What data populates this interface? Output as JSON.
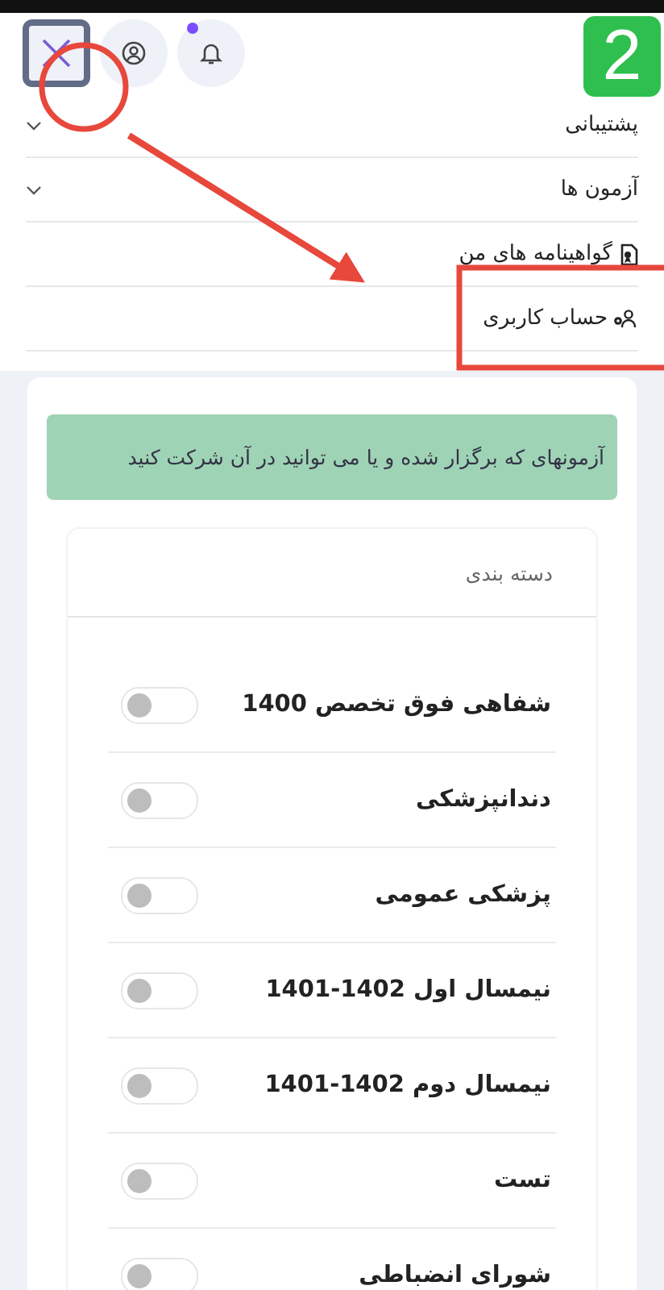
{
  "header": {
    "notifications": {
      "unread": true
    }
  },
  "menu": [
    {
      "label": "پشتیبانی",
      "kind": "dropdown"
    },
    {
      "label": "آزمون ها",
      "kind": "dropdown"
    },
    {
      "label": "گواهینامه های من",
      "kind": "certificate"
    },
    {
      "label": "حساب کاربری",
      "kind": "account"
    }
  ],
  "alert": "آزمونهای که برگزار شده و یا می توانید در آن شرکت کنید",
  "categories": {
    "title": "دسته بندی",
    "items": [
      {
        "label": "شفاهی فوق تخصص 1400",
        "on": false
      },
      {
        "label": "دندانپزشکی",
        "on": false
      },
      {
        "label": "پزشکی عمومی",
        "on": false
      },
      {
        "label": "نیمسال اول 1402-1401",
        "on": false
      },
      {
        "label": "نیمسال دوم 1402-1401",
        "on": false
      },
      {
        "label": "تست",
        "on": false
      },
      {
        "label": "شورای انضباطی",
        "on": false
      }
    ]
  },
  "annotation": {
    "step": "2"
  }
}
